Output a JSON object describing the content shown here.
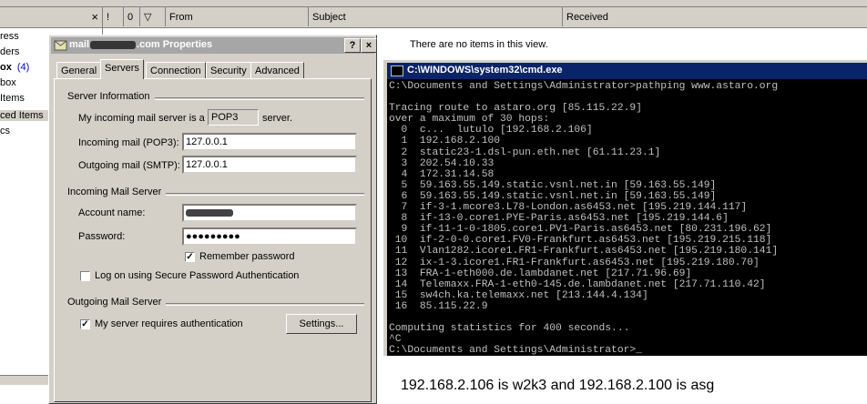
{
  "folders": {
    "items": [
      {
        "label": "ress",
        "bold": false
      },
      {
        "label": "ders",
        "bold": false
      },
      {
        "label": "ox",
        "bold": true,
        "count": "(4)"
      },
      {
        "label": "box",
        "bold": false
      },
      {
        "label": " Items",
        "bold": false
      },
      {
        "label": "ced Items",
        "bold": false
      },
      {
        "label": "cs",
        "bold": false
      }
    ],
    "close": "×"
  },
  "message_list": {
    "columns": [
      "!",
      "0",
      "▽",
      "From",
      "Subject",
      "Received"
    ],
    "empty_text": "There are no items in this view."
  },
  "dialog": {
    "title_suffix": ".com Properties",
    "title_prefix": "mail",
    "help_btn": "?",
    "close_btn": "×",
    "tabs": [
      "General",
      "Servers",
      "Connection",
      "Security",
      "Advanced"
    ],
    "active_tab": "Servers",
    "server_info_label": "Server Information",
    "incoming_server_type_label": "My incoming mail server is a",
    "incoming_server_type": "POP3",
    "incoming_server_type_suffix": "server.",
    "incoming_pop3_label": "Incoming mail (POP3):",
    "incoming_pop3_value": "127.0.0.1",
    "outgoing_smtp_label": "Outgoing mail (SMTP):",
    "outgoing_smtp_value": "127.0.0.1",
    "incoming_mail_server_label": "Incoming Mail Server",
    "account_name_label": "Account name:",
    "password_label": "Password:",
    "password_value": "●●●●●●●●●",
    "remember_password_label": "Remember password",
    "remember_password_checked": true,
    "spa_label": "Log on using Secure Password Authentication",
    "spa_checked": false,
    "outgoing_mail_server_label": "Outgoing Mail Server",
    "requires_auth_label": "My server requires authentication",
    "requires_auth_checked": true,
    "settings_button": "Settings..."
  },
  "cmd": {
    "title": "C:\\WINDOWS\\system32\\cmd.exe",
    "lines": [
      "C:\\Documents and Settings\\Administrator>pathping www.astaro.org",
      "",
      "Tracing route to astaro.org [85.115.22.9]",
      "over a maximum of 30 hops:",
      "  0  c...  lutulo [192.168.2.106]",
      "  1  192.168.2.100",
      "  2  static23-1.dsl-pun.eth.net [61.11.23.1]",
      "  3  202.54.10.33",
      "  4  172.31.14.58",
      "  5  59.163.55.149.static.vsnl.net.in [59.163.55.149]",
      "  6  59.163.55.149.static.vsnl.net.in [59.163.55.149]",
      "  7  if-3-1.mcore3.L78-London.as6453.net [195.219.144.117]",
      "  8  if-13-0.core1.PYE-Paris.as6453.net [195.219.144.6]",
      "  9  if-11-1-0-1805.core1.PV1-Paris.as6453.net [80.231.196.62]",
      " 10  if-2-0-0.core1.FV0-Frankfurt.as6453.net [195.219.215.118]",
      " 11  Vlan1282.icore1.FR1-Frankfurt.as6453.net [195.219.180.141]",
      " 12  ix-1-3.icore1.FR1-Frankfurt.as6453.net [195.219.180.70]",
      " 13  FRA-1-eth000.de.lambdanet.net [217.71.96.69]",
      " 14  Telemaxx.FRA-1-eth0-145.de.lambdanet.net [217.71.110.42]",
      " 15  sw4ch.ka.telemaxx.net [213.144.4.134]",
      " 16  85.115.22.9",
      "",
      "Computing statistics for 400 seconds...",
      "^C",
      "C:\\Documents and Settings\\Administrator>_"
    ]
  },
  "caption": "192.168.2.106 is w2k3 and 192.168.2.100 is asg"
}
